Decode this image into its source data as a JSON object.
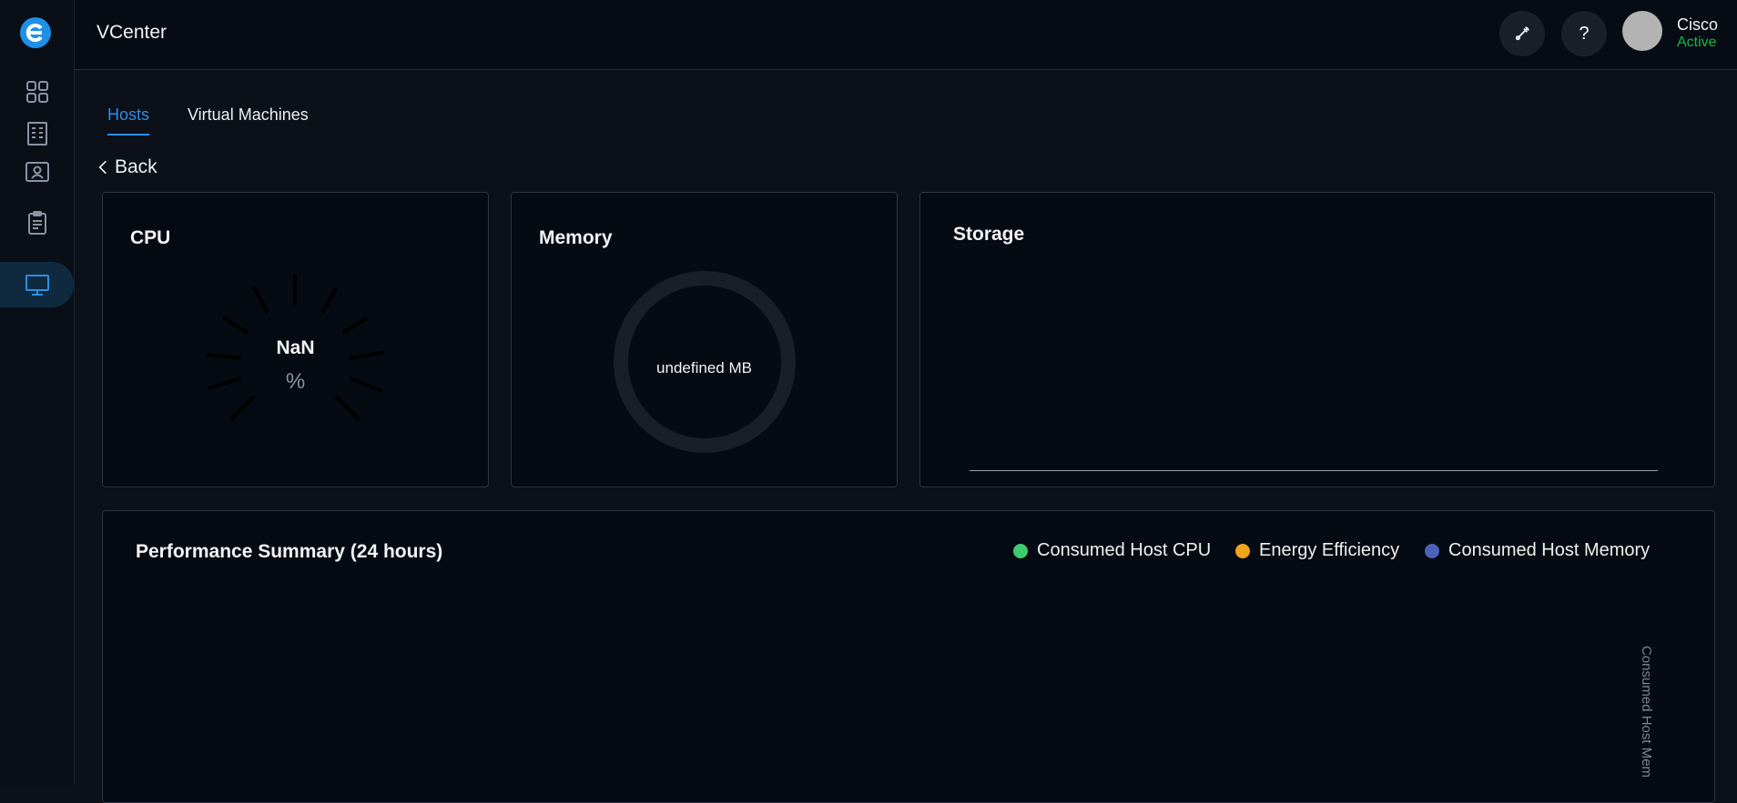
{
  "app": {
    "title": "VCenter"
  },
  "user": {
    "name": "Cisco",
    "status": "Active"
  },
  "topbar": {
    "help_label": "?"
  },
  "sidebar": {
    "items": [
      {
        "icon": "dashboard-grid-icon"
      },
      {
        "icon": "building-icon"
      },
      {
        "icon": "id-card-icon"
      },
      {
        "icon": "clipboard-icon"
      },
      {
        "icon": "monitor-icon",
        "active": true
      }
    ]
  },
  "tabs": [
    {
      "label": "Hosts",
      "active": true
    },
    {
      "label": "Virtual Machines",
      "active": false
    }
  ],
  "back_label": "Back",
  "cpu": {
    "title": "CPU",
    "value": "NaN",
    "unit": "%"
  },
  "memory": {
    "title": "Memory",
    "value": "undefined MB"
  },
  "storage": {
    "title": "Storage"
  },
  "performance": {
    "title": "Performance Summary (24 hours)",
    "legend": [
      {
        "label": "Consumed Host CPU",
        "color": "#3ecb6c"
      },
      {
        "label": "Energy Efficiency",
        "color": "#f0a418"
      },
      {
        "label": "Consumed Host Memory",
        "color": "#4a62b8"
      }
    ],
    "axis_label": "Consumed Host Mem"
  },
  "colors": {
    "accent": "#2b8fe6",
    "active_status": "#17b84a"
  }
}
